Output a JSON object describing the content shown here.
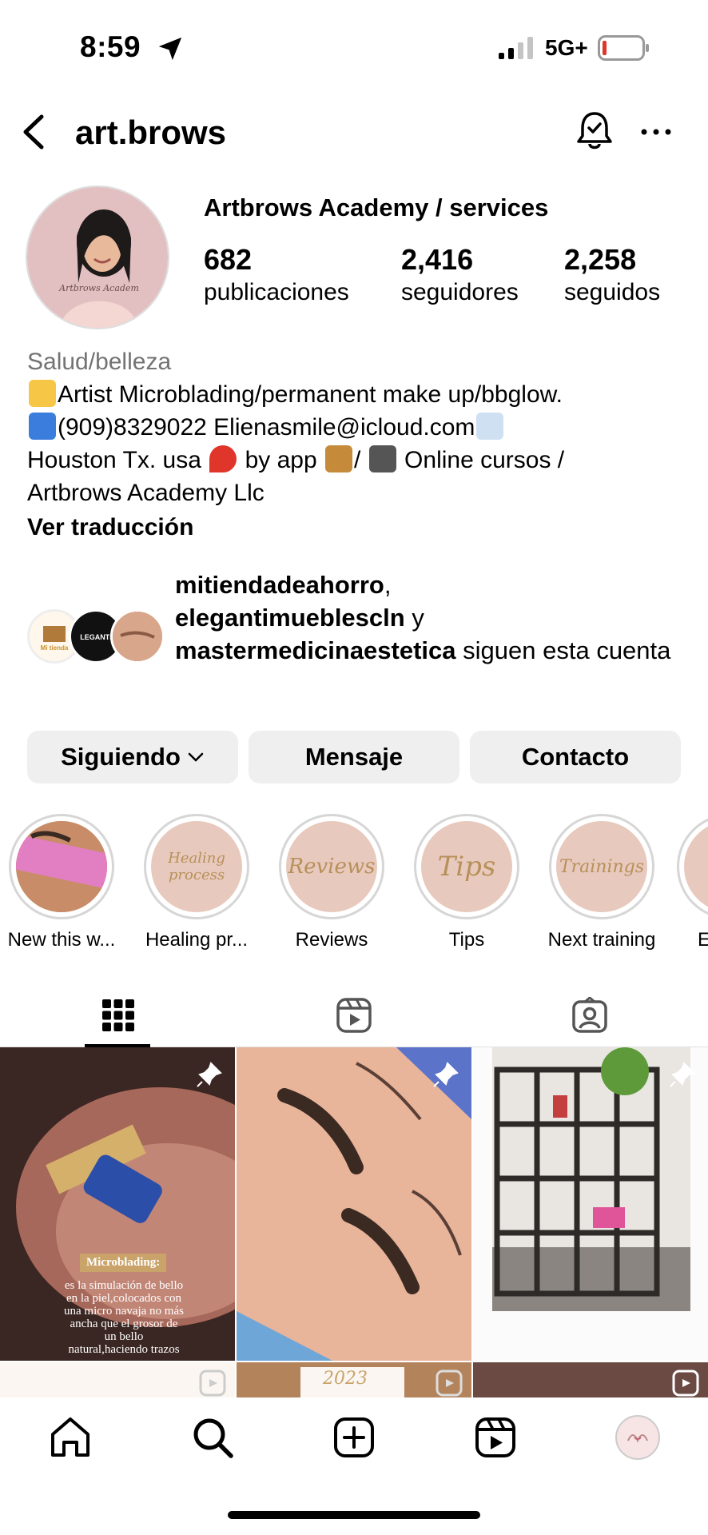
{
  "status": {
    "time": "8:59",
    "network": "5G+"
  },
  "header": {
    "username": "art.brows",
    "icons": [
      "back-arrow-icon",
      "notification-bell-icon",
      "more-options-icon"
    ]
  },
  "profile": {
    "display_name": "Artbrows Academy / services",
    "avatar_text": "Artbrows Academ",
    "stats": [
      {
        "value": "682",
        "label": "publicaciones"
      },
      {
        "value": "2,416",
        "label": "seguidores"
      },
      {
        "value": "2,258",
        "label": "seguidos"
      }
    ],
    "bio": {
      "category": "Salud/belleza",
      "line1": "Artist Microblading/permanent make up/bbglow.",
      "line2": "(909)8329022 Elienasmile@icloud.com",
      "line3a": "Houston Tx. usa",
      "line3b": "by app",
      "line3c": "/",
      "line3d": "Online cursos /",
      "line4": "Artbrows Academy Llc",
      "translate": "Ver traducción"
    },
    "followed_by": {
      "account1": "mitiendadeahorro",
      "separator1": ",",
      "account2": "elegantimueblescln",
      "connector": " y",
      "account3": "mastermedicinaestetica",
      "suffix": " siguen esta cuenta",
      "avatar1_text": "Mi tienda",
      "avatar2_text": "LEGANTI"
    }
  },
  "actions": {
    "following": "Siguiendo",
    "message": "Mensaje",
    "contact": "Contacto"
  },
  "highlights": [
    {
      "label": "New this w...",
      "cover": "photo"
    },
    {
      "label": "Healing pr...",
      "cover": "Healing process"
    },
    {
      "label": "Reviews",
      "cover": "Reviews"
    },
    {
      "label": "Tips",
      "cover": "Tips"
    },
    {
      "label": "Next training",
      "cover": "Trainings"
    },
    {
      "label": "E",
      "cover": ""
    }
  ],
  "tabs": [
    "posts-grid-tab",
    "reels-tab",
    "tagged-tab"
  ],
  "posts": {
    "post1_title": "Microblading:",
    "post1_caption": "es la simulación de bello en la piel,colocados con una micro navaja no más ancha que el grosor de un bello natural,haciendo trazos con",
    "year": "2023"
  },
  "colors": {
    "accent_gold": "#c9a36a",
    "button_bg": "#efefef",
    "category_gray": "#737373",
    "highlight_bg": "#e8c9bd"
  }
}
